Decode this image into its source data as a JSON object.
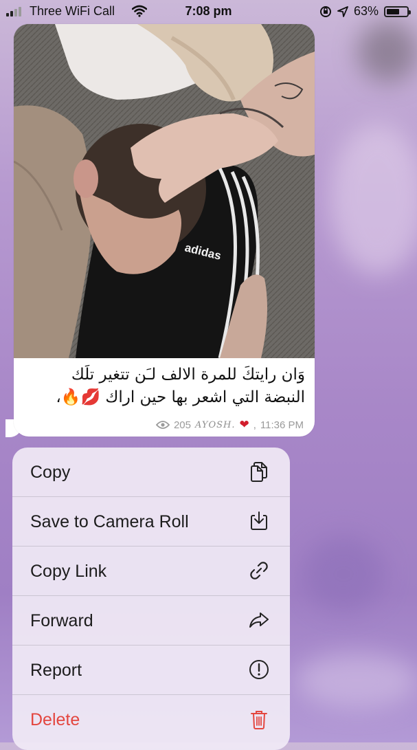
{
  "status_bar": {
    "carrier": "Three WiFi Call",
    "time": "7:08 pm",
    "battery_percent": "63%",
    "battery_level": 0.63
  },
  "message": {
    "caption_line1": "وَان رايتكَ للمرة الالف لـَن تتغير تلَك",
    "caption_line2": "النبضة التي اشعر بها حين اراك 💋🔥،",
    "views": "205",
    "sender": "AYOSH.",
    "time": "11:36 PM",
    "photo_text": "adidas"
  },
  "menu": {
    "items": [
      {
        "label": "Copy",
        "icon": "copy-icon"
      },
      {
        "label": "Save to Camera Roll",
        "icon": "download-icon"
      },
      {
        "label": "Copy Link",
        "icon": "link-icon"
      },
      {
        "label": "Forward",
        "icon": "forward-arrow-icon"
      },
      {
        "label": "Report",
        "icon": "exclamation-circle-icon"
      },
      {
        "label": "Delete",
        "icon": "trash-icon"
      }
    ]
  },
  "colors": {
    "delete": "#e3463f",
    "heart": "#d21e2d",
    "background": "#a887c8"
  }
}
